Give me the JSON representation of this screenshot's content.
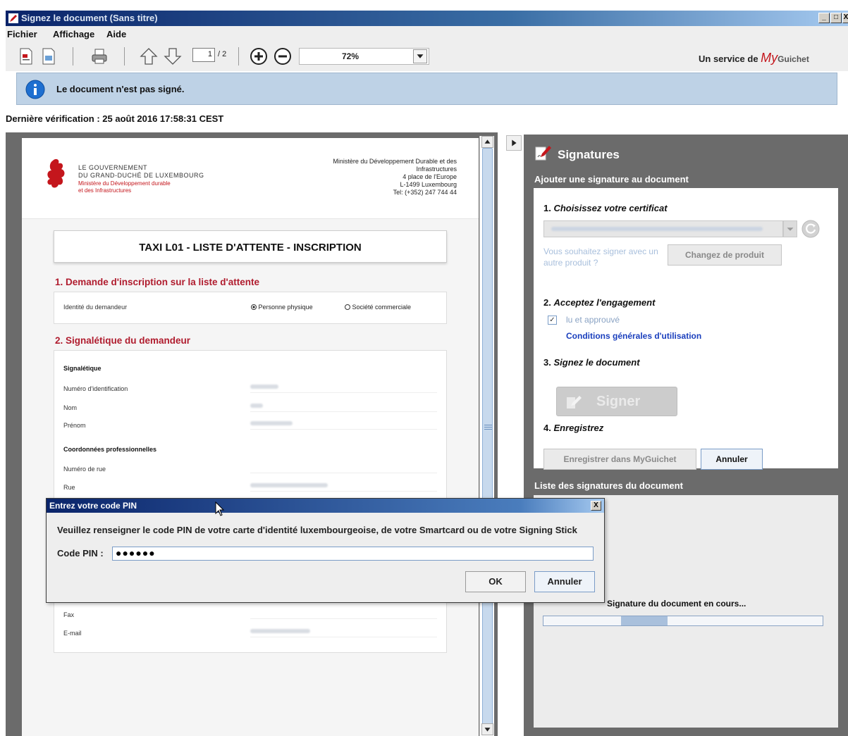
{
  "window": {
    "title": "Signez le document (Sans titre)",
    "min": "_",
    "max": "□",
    "close": "X"
  },
  "menu": {
    "items": [
      "Fichier",
      "Affichage",
      "Aide"
    ]
  },
  "toolbar": {
    "page_current": "1",
    "page_total": "/ 2",
    "zoom": "72%",
    "service_prefix": "Un service de",
    "service_brand_my": "My",
    "service_brand_rest": "Guichet"
  },
  "banner": {
    "text": "Le document n'est pas signé."
  },
  "last_check": "Dernière vérification : 25 août 2016 17:58:31 CEST",
  "document": {
    "gov_line1": "LE GOUVERNEMENT",
    "gov_line2": "DU GRAND-DUCHÉ DE LUXEMBOURG",
    "gov_line3": "Ministère du Développement durable",
    "gov_line4": "et des Infrastructures",
    "address": [
      "Ministère du Développement Durable et des",
      "Infrastructures",
      "4 place de l'Europe",
      "L-1499 Luxembourg",
      "Tel: (+352) 247 744 44"
    ],
    "form_title": "TAXI L01 - LISTE D'ATTENTE - INSCRIPTION",
    "section1": "1. Demande d'inscription sur la liste d'attente",
    "identity_label": "Identité du demandeur",
    "option_person": "Personne physique",
    "option_company": "Société commerciale",
    "section2": "2. Signalétique du demandeur",
    "sub1": "Signalétique",
    "field_id": "Numéro d'identification",
    "field_nom": "Nom",
    "field_prenom": "Prénom",
    "sub2": "Coordonnées professionnelles",
    "field_numrue": "Numéro de rue",
    "field_rue": "Rue",
    "field_fax": "Fax",
    "field_email": "E-mail"
  },
  "signatures": {
    "title": "Signatures",
    "subtitle": "Ajouter une signature au document",
    "step1_num": "1.",
    "step1": "Choisissez votre certificat",
    "other_product": "Vous souhaitez signer avec un autre produit ?",
    "change_product": "Changez de produit",
    "step2_num": "2.",
    "step2": "Acceptez l'engagement",
    "check_mark": "✓",
    "read_approved": "lu et approuvé",
    "cgu": "Conditions générales d'utilisation",
    "step3_num": "3.",
    "step3": "Signez le document",
    "sign_button": "Signer",
    "step4_num": "4.",
    "step4": "Enregistrez",
    "save_button": "Enregistrer dans MyGuichet",
    "cancel_button": "Annuler",
    "list_title": "Liste des signatures du document",
    "progress_label": "Signature du document en cours..."
  },
  "pin_dialog": {
    "title": "Entrez votre code PIN",
    "close": "X",
    "message": "Veuillez renseigner le code PIN de votre carte d'identité luxembourgeoise, de votre Smartcard ou de votre Signing Stick",
    "label": "Code PIN :",
    "value": "●●●●●●",
    "ok": "OK",
    "cancel": "Annuler"
  },
  "colors": {
    "accent_red": "#c4161c",
    "banner_blue": "#bed2e6",
    "link_blue": "#1a3fbd",
    "panel_gray": "#6b6b6b"
  }
}
